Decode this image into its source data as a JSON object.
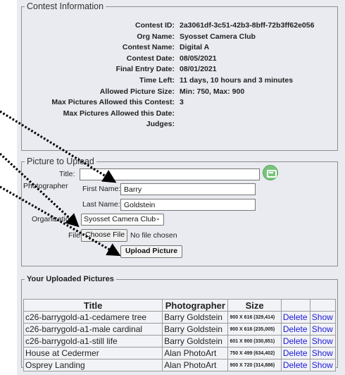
{
  "contest": {
    "legend": "Contest Information",
    "rows": [
      {
        "label": "Contest ID:",
        "value": "2a3061df-3c51-42b3-8bff-72b3ff62e056"
      },
      {
        "label": "Org Name:",
        "value": "Syosset Camera Club"
      },
      {
        "label": "Contest Name:",
        "value": "Digital A"
      },
      {
        "label": "Contest Date:",
        "value": "08/05/2021"
      },
      {
        "label": "Final Entry Date:",
        "value": "08/01/2021"
      },
      {
        "label": "Time Left:",
        "value": "11 days, 10 hours and 3 minutes"
      },
      {
        "label": "Allowed Picture Size:",
        "value": "Min: 750, Max: 900"
      },
      {
        "label": "Max Pictures Allowed this Contest:",
        "value": "3"
      },
      {
        "label": "Max Pictures Allowed this Date:",
        "value": ""
      },
      {
        "label": "Judges:",
        "value": ""
      }
    ]
  },
  "upload": {
    "legend": "Picture to Upload",
    "title_label": "Title:",
    "title_value": "",
    "photographer_label": "Photographer",
    "first_name_label": "First Name:",
    "first_name_value": "Barry",
    "last_name_label": "Last Name:",
    "last_name_value": "Goldstein",
    "organization_label": "Organization:",
    "organization_value": "Syosset Camera Club",
    "file_label": "File:",
    "choose_file_label": "Choose File",
    "no_file_text": "No file chosen",
    "upload_button": "Upload Picture"
  },
  "uploaded": {
    "legend": "Your Uploaded Pictures",
    "headers": [
      "Title",
      "Photographer",
      "Size",
      "",
      ""
    ],
    "rows": [
      {
        "title": "c26-barrygold-a1-cedamere tree",
        "photographer": "Barry Goldstein",
        "size": "900 X 616 (329,414)",
        "delete": "Delete",
        "show": "Show"
      },
      {
        "title": "c26-barrygold-a1-male cardinal",
        "photographer": "Barry Goldstein",
        "size": "900 X 616 (235,005)",
        "delete": "Delete",
        "show": "Show"
      },
      {
        "title": "c26-barrygold-a1-still life",
        "photographer": "Barry Goldstein",
        "size": "601 X 900 (330,851)",
        "delete": "Delete",
        "show": "Show"
      },
      {
        "title": "House at Cedermer",
        "photographer": "Alan PhotoArt",
        "size": "750 X 499 (634,402)",
        "delete": "Delete",
        "show": "Show"
      },
      {
        "title": "Osprey Landing",
        "photographer": "Alan PhotoArt",
        "size": "900 X 720 (314,886)",
        "delete": "Delete",
        "show": "Show"
      }
    ]
  },
  "icons": {
    "chat": "chat-bubble-icon",
    "chevron": "chevron-down-icon"
  },
  "colors": {
    "link": "#1a1adb",
    "panel": "#e9ebf0",
    "chat_icon": "#79c37d"
  }
}
